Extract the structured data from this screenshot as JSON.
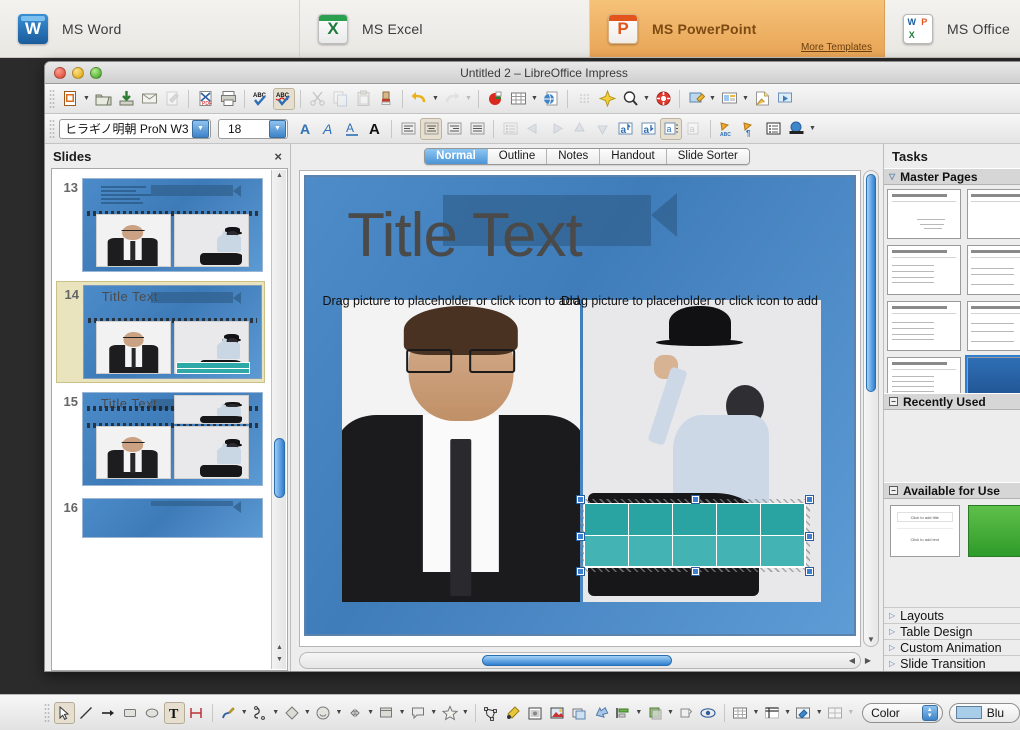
{
  "template_bar": {
    "items": [
      {
        "label": "MS Word",
        "icon": "word-icon",
        "selected": false
      },
      {
        "label": "MS Excel",
        "icon": "excel-icon",
        "selected": false
      },
      {
        "label": "MS PowerPoint",
        "icon": "powerpoint-icon",
        "selected": true,
        "sub_link": "More Templates"
      },
      {
        "label": "MS Office",
        "icon": "office-icon",
        "selected": false
      }
    ]
  },
  "window": {
    "title": "Untitled 2 – LibreOffice Impress",
    "controls": {
      "close": "close-button",
      "minimize": "minimize-button",
      "zoom": "zoom-button"
    }
  },
  "standard_toolbar": [
    {
      "name": "new-document",
      "glyph": "doc"
    },
    {
      "name": "new-dropdown",
      "glyph": "caret"
    },
    {
      "name": "open-document",
      "glyph": "folder"
    },
    {
      "name": "save-document",
      "glyph": "save"
    },
    {
      "name": "email-document",
      "glyph": "mail"
    },
    {
      "name": "edit-file",
      "glyph": "pencil-doc",
      "disabled": true
    },
    {
      "name": "export-pdf",
      "glyph": "pdf"
    },
    {
      "name": "print-document",
      "glyph": "printer"
    },
    {
      "name": "spelling",
      "glyph": "abc-check"
    },
    {
      "name": "autospellcheck",
      "glyph": "abc-check-red",
      "active": true
    },
    {
      "name": "cut",
      "glyph": "scissors",
      "disabled": true
    },
    {
      "name": "copy",
      "glyph": "copy",
      "disabled": true
    },
    {
      "name": "paste",
      "glyph": "clipboard",
      "disabled": true
    },
    {
      "name": "clone-formatting",
      "glyph": "paintbrush"
    },
    {
      "name": "undo",
      "glyph": "undo-arrow"
    },
    {
      "name": "undo-dropdown",
      "glyph": "caret"
    },
    {
      "name": "redo",
      "glyph": "redo-arrow",
      "disabled": true
    },
    {
      "name": "redo-dropdown",
      "glyph": "caret",
      "disabled": true
    },
    {
      "name": "chart",
      "glyph": "chart"
    },
    {
      "name": "table",
      "glyph": "table"
    },
    {
      "name": "table-dropdown",
      "glyph": "caret"
    },
    {
      "name": "hyperlink",
      "glyph": "globe-doc"
    },
    {
      "name": "show-draw-functions",
      "glyph": "dots"
    },
    {
      "name": "display-grid",
      "glyph": "star-grid"
    },
    {
      "name": "zoom",
      "glyph": "magnifier"
    },
    {
      "name": "zoom-dropdown",
      "glyph": "caret"
    },
    {
      "name": "help",
      "glyph": "lifesaver"
    },
    {
      "name": "master-slide",
      "glyph": "master"
    },
    {
      "name": "master-dropdown",
      "glyph": "caret"
    },
    {
      "name": "slide-layout",
      "glyph": "layout"
    },
    {
      "name": "layout-dropdown",
      "glyph": "caret"
    },
    {
      "name": "new-slide",
      "glyph": "new-slide"
    },
    {
      "name": "start-slideshow",
      "glyph": "present"
    }
  ],
  "format_toolbar": {
    "font_name": "ヒラギノ明朝 ProN W3",
    "font_size": "18",
    "buttons": [
      {
        "name": "bold",
        "glyph": "A-bold"
      },
      {
        "name": "italic",
        "glyph": "A-italic"
      },
      {
        "name": "underline",
        "glyph": "A-underline"
      },
      {
        "name": "font-color",
        "glyph": "A-color"
      },
      {
        "name": "align-left",
        "glyph": "align-left"
      },
      {
        "name": "align-center",
        "glyph": "align-center",
        "active": true
      },
      {
        "name": "align-right",
        "glyph": "align-right"
      },
      {
        "name": "align-justify",
        "glyph": "align-justify"
      },
      {
        "name": "bullet-list",
        "glyph": "bullets",
        "disabled": true
      },
      {
        "name": "promote",
        "glyph": "arrow-left",
        "disabled": true
      },
      {
        "name": "demote",
        "glyph": "arrow-right",
        "disabled": true
      },
      {
        "name": "move-up",
        "glyph": "arrow-up",
        "disabled": true
      },
      {
        "name": "move-down",
        "glyph": "arrow-down",
        "disabled": true
      },
      {
        "name": "increase-font",
        "glyph": "a-up"
      },
      {
        "name": "decrease-font",
        "glyph": "a-down"
      },
      {
        "name": "char-spacing",
        "glyph": "a-spacing",
        "active": true
      },
      {
        "name": "line-spacing",
        "glyph": "a-line"
      },
      {
        "name": "insert-text-box",
        "glyph": "abc-box"
      },
      {
        "name": "formatting-marks",
        "glyph": "pilcrow"
      },
      {
        "name": "insert-fields",
        "glyph": "fields"
      },
      {
        "name": "insert-image",
        "glyph": "image"
      },
      {
        "name": "insert-image-dropdown",
        "glyph": "caret"
      }
    ]
  },
  "slides_pane": {
    "title": "Slides",
    "close_icon": "×",
    "slides": [
      {
        "number": "13",
        "selected": false,
        "title": "",
        "has_table": false,
        "has_lines": true
      },
      {
        "number": "14",
        "selected": true,
        "title": "Title Text",
        "has_table": true,
        "has_lines": false
      },
      {
        "number": "15",
        "selected": false,
        "title": "Title Text",
        "has_table": false,
        "has_lines": false
      },
      {
        "number": "16",
        "selected": false,
        "title": "",
        "has_table": false,
        "has_lines": false
      }
    ]
  },
  "view_tabs": [
    {
      "label": "Normal",
      "active": true
    },
    {
      "label": "Outline",
      "active": false
    },
    {
      "label": "Notes",
      "active": false
    },
    {
      "label": "Handout",
      "active": false
    },
    {
      "label": "Slide Sorter",
      "active": false
    }
  ],
  "slide_canvas": {
    "title_text": "Title Text",
    "left_placeholder_caption": "Drag picture to placeholder or click icon to add",
    "right_placeholder_caption": "Drag picture to placeholder or click icon to add",
    "table": {
      "columns": 5,
      "rows": 2,
      "fill_color": "#2aa3a3",
      "selected": true
    }
  },
  "tasks_pane": {
    "title": "Tasks",
    "sections": [
      {
        "label": "Master Pages",
        "expanded": true,
        "expander": "▽"
      },
      {
        "label": "Recently Used",
        "expanded": true,
        "expander": "−"
      },
      {
        "label": "Available for Use",
        "expanded": true,
        "expander": "−"
      }
    ],
    "collapsed_panels": [
      {
        "label": "Layouts"
      },
      {
        "label": "Table Design"
      },
      {
        "label": "Custom Animation"
      },
      {
        "label": "Slide Transition"
      }
    ]
  },
  "draw_toolbar": {
    "buttons": [
      {
        "name": "select-tool",
        "glyph": "cursor",
        "active": true
      },
      {
        "name": "line-tool",
        "glyph": "line"
      },
      {
        "name": "arrow-tool",
        "glyph": "arrow"
      },
      {
        "name": "rectangle-tool",
        "glyph": "rect"
      },
      {
        "name": "ellipse-tool",
        "glyph": "ellipse"
      },
      {
        "name": "text-box-tool",
        "glyph": "T",
        "active": true
      },
      {
        "name": "dimension-line-tool",
        "glyph": "dimension"
      },
      {
        "name": "curve-tool",
        "glyph": "curve"
      },
      {
        "name": "connector-tool",
        "glyph": "connector"
      },
      {
        "name": "basic-shapes",
        "glyph": "diamond"
      },
      {
        "name": "symbol-shapes",
        "glyph": "smiley"
      },
      {
        "name": "block-arrows",
        "glyph": "block-arrow"
      },
      {
        "name": "flowchart-shapes",
        "glyph": "flowchart"
      },
      {
        "name": "callout-shapes",
        "glyph": "callout"
      },
      {
        "name": "stars-shapes",
        "glyph": "star"
      },
      {
        "name": "points-tool",
        "glyph": "points"
      },
      {
        "name": "glue-points-tool",
        "glyph": "glue"
      },
      {
        "name": "from-file",
        "glyph": "from-file"
      },
      {
        "name": "gallery",
        "glyph": "gallery"
      },
      {
        "name": "rotate-tool",
        "glyph": "rotate"
      },
      {
        "name": "align-objects",
        "glyph": "align-obj"
      },
      {
        "name": "arrange-objects",
        "glyph": "arrange"
      },
      {
        "name": "shadow-tool",
        "glyph": "shadow"
      },
      {
        "name": "crop-tool",
        "glyph": "crop"
      },
      {
        "name": "filter-tool",
        "glyph": "filter"
      },
      {
        "name": "table-insert",
        "glyph": "table"
      },
      {
        "name": "borders",
        "glyph": "borders"
      },
      {
        "name": "area-style",
        "glyph": "area-fill"
      },
      {
        "name": "merge-cells",
        "glyph": "merge"
      }
    ],
    "fill_style": "Color",
    "fill_color": "Blu"
  }
}
